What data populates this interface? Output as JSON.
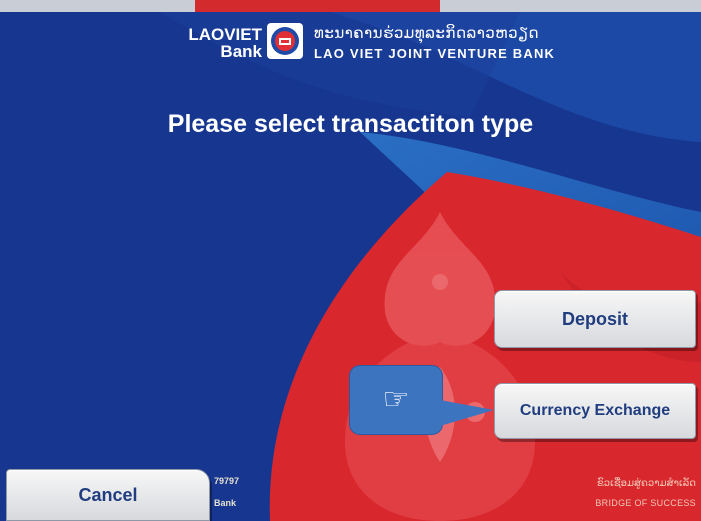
{
  "bank": {
    "name_line1": "LAOVIET",
    "name_line2": "Bank",
    "lao_name": "ທະນາຄານຮ່ວມທຸລະກິດລາວຫວຽດ",
    "english_name": "LAO VIET JOINT VENTURE BANK"
  },
  "prompt": "Please select transactiton type",
  "buttons": {
    "deposit": "Deposit",
    "currency_exchange": "Currency Exchange",
    "cancel": "Cancel"
  },
  "hint_icon": "pointing-hand-icon",
  "hint_glyph": "☞",
  "footer": {
    "left_text_1": "79797",
    "left_text_2": "Bank",
    "slogan_lao": "ຂົວເຊື່ອມສູ່ຄວາມສຳເລັດ",
    "slogan_en": "BRIDGE OF SUCCESS"
  },
  "colors": {
    "background_blue": "#16368f",
    "accent_red": "#d9272e",
    "button_text": "#203d80",
    "hint_blue": "#3d74c0"
  }
}
